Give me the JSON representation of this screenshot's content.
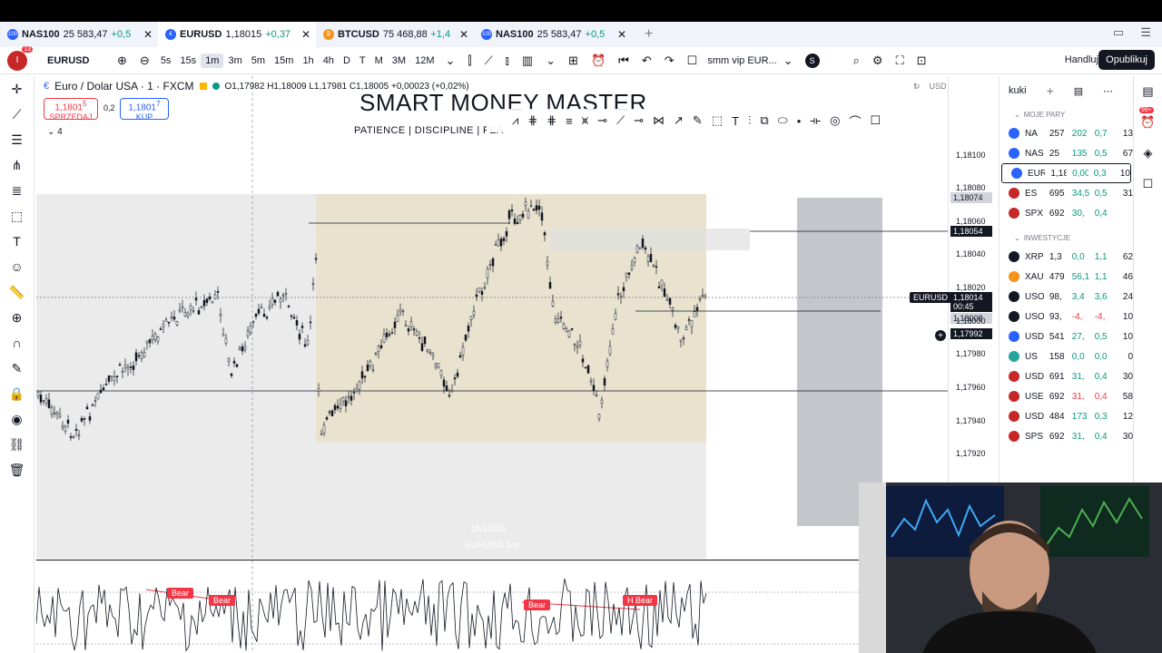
{
  "tabs": [
    {
      "name": "NAS100",
      "price": "25 583,47",
      "change": "+0,5",
      "badge": "100",
      "badge_color": "#2962ff"
    },
    {
      "name": "EURUSD",
      "price": "1,18015",
      "change": "+0,37",
      "badge": "€",
      "badge_color": "#2962ff"
    },
    {
      "name": "BTCUSD",
      "price": "75 468,88",
      "change": "+1,4",
      "badge": "₿",
      "badge_color": "#f7931a"
    },
    {
      "name": "NAS100",
      "price": "25 583,47",
      "change": "+0,5",
      "badge": "100",
      "badge_color": "#2962ff"
    }
  ],
  "toolbar": {
    "avatar": "I",
    "notifications": "13",
    "symbol": "EURUSD",
    "intervals": [
      "5s",
      "15s",
      "1m",
      "3m",
      "5m",
      "15m",
      "1h",
      "4h",
      "D",
      "T",
      "M",
      "3M",
      "12M"
    ],
    "selected_interval": "1m",
    "layout_name": "smm vip EUR...",
    "layout_initials": "S",
    "trade_label": "Handluj",
    "publish_label": "Opublikuj"
  },
  "legend": {
    "title": "Euro / Dolar USA · 1 · FXCM",
    "ohlc": "O1,17982 H1,18009 L1,17981 C1,18005 +0,00023 (+0,02%)",
    "sell_price": "1,1801",
    "sell_sup": "5",
    "sell_label": "SPRZEDAJ",
    "spread": "0,2",
    "buy_price": "1,1801",
    "buy_sup": "7",
    "buy_label": "KUP",
    "indicators_count": "4"
  },
  "watermark": {
    "title": "SMART MONEY MASTER",
    "subtitle": "PATIENCE | DISCIPLINE | FEA"
  },
  "price_scale": {
    "currency": "USD",
    "ticks": [
      "1,18100",
      "1,18080",
      "1,18060",
      "1,18040",
      "1,18020",
      "1,18000",
      "1,17980",
      "1,17960",
      "1,17940",
      "1,17920"
    ],
    "hl_label": "1,18074",
    "level_label": "1,18054",
    "current_price": "1,18014",
    "countdown": "00:45",
    "mid_label": "1,18008",
    "cursor_price": "1,17992",
    "symbol_tag": "EURUSD"
  },
  "watchlist": {
    "name": "kuki",
    "sections": [
      {
        "title": "MOJE PARY",
        "rows": [
          {
            "sym": "NA",
            "last": "257",
            "chg": "202",
            "pct": "0,7",
            "vol": "13",
            "color": "#2962ff",
            "chg_color": "#089981"
          },
          {
            "sym": "NAS",
            "last": "25",
            "chg": "135",
            "pct": "0,5",
            "vol": "67",
            "color": "#2962ff",
            "chg_color": "#089981"
          },
          {
            "sym": "EUR",
            "last": "1,18",
            "chg": "0,00",
            "pct": "0,3",
            "vol": "10",
            "color": "#2962ff",
            "chg_color": "#089981"
          },
          {
            "sym": "ES",
            "last": "695",
            "chg": "34,5",
            "pct": "0,5",
            "vol": "31",
            "color": "#c62828",
            "chg_color": "#089981"
          },
          {
            "sym": "SPX",
            "last": "692",
            "chg": "30,",
            "pct": "0,4",
            "vol": "",
            "color": "#c62828",
            "chg_color": "#089981"
          }
        ]
      },
      {
        "title": "INWESTYCJE",
        "rows": [
          {
            "sym": "XRP",
            "last": "1,3",
            "chg": "0,0",
            "pct": "1,1",
            "vol": "62",
            "color": "#131722",
            "chg_color": "#089981"
          },
          {
            "sym": "XAU",
            "last": "479",
            "chg": "56,1",
            "pct": "1,1",
            "vol": "46",
            "color": "#f7931a",
            "chg_color": "#089981"
          },
          {
            "sym": "USO",
            "last": "98,",
            "chg": "3,4",
            "pct": "3,6",
            "vol": "24",
            "color": "#131722",
            "chg_color": "#089981"
          },
          {
            "sym": "USO",
            "last": "93,",
            "chg": "-4,",
            "pct": "-4,",
            "vol": "10",
            "color": "#131722",
            "chg_color": "#f23645"
          },
          {
            "sym": "USD",
            "last": "541",
            "chg": "27,",
            "pct": "0,5",
            "vol": "10",
            "color": "#2962ff",
            "chg_color": "#089981"
          },
          {
            "sym": "US",
            "last": "158",
            "chg": "0,0",
            "pct": "0,0",
            "vol": "0",
            "color": "#26a69a",
            "chg_color": "#089981"
          },
          {
            "sym": "USD",
            "last": "691",
            "chg": "31,",
            "pct": "0,4",
            "vol": "30",
            "color": "#c62828",
            "chg_color": "#089981"
          },
          {
            "sym": "USE",
            "last": "692",
            "chg": "31,",
            "pct": "0,4",
            "vol": "58",
            "color": "#c62828",
            "chg_color": "#f23645"
          },
          {
            "sym": "USD",
            "last": "484",
            "chg": "173",
            "pct": "0,3",
            "vol": "12",
            "color": "#c62828",
            "chg_color": "#089981"
          },
          {
            "sym": "SPS",
            "last": "692",
            "chg": "31,",
            "pct": "0,4",
            "vol": "30",
            "color": "#c62828",
            "chg_color": "#089981"
          }
        ]
      }
    ]
  },
  "side_badge": "99+",
  "faded_labels": [
    "16/12/26",
    "EURUSD 1m"
  ],
  "indicator": {
    "signals": [
      "Bear",
      "Bear",
      "Bear",
      "H Bear"
    ]
  },
  "colors": {
    "accent": "#2962ff",
    "bull": "#089981",
    "bear": "#f23645",
    "zone": "#e8e2cf"
  }
}
